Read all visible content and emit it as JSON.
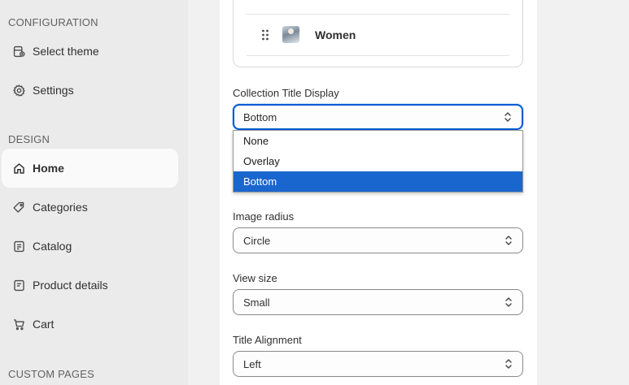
{
  "sidebar": {
    "configuration_label": "CONFIGURATION",
    "design_label": "DESIGN",
    "custom_pages_label": "CUSTOM PAGES",
    "items": [
      {
        "label": "Select theme",
        "icon": "theme-icon"
      },
      {
        "label": "Settings",
        "icon": "gear-icon"
      },
      {
        "label": "Home",
        "icon": "home-icon",
        "active": true
      },
      {
        "label": "Categories",
        "icon": "tag-icon"
      },
      {
        "label": "Catalog",
        "icon": "catalog-icon"
      },
      {
        "label": "Product details",
        "icon": "product-details-icon"
      },
      {
        "label": "Cart",
        "icon": "cart-icon"
      }
    ]
  },
  "collection_list": {
    "items": [
      {
        "label": "Women"
      }
    ]
  },
  "fields": {
    "collection_title_display": {
      "label": "Collection Title Display",
      "value": "Bottom",
      "options": [
        "None",
        "Overlay",
        "Bottom"
      ]
    },
    "image_radius": {
      "label": "Image radius",
      "value": "Circle"
    },
    "view_size": {
      "label": "View size",
      "value": "Small"
    },
    "title_alignment": {
      "label": "Title Alignment",
      "value": "Left"
    }
  },
  "colors": {
    "accent": "#005bd3",
    "selected_option": "#1a66cf",
    "sidebar_bg": "#ebebeb"
  }
}
